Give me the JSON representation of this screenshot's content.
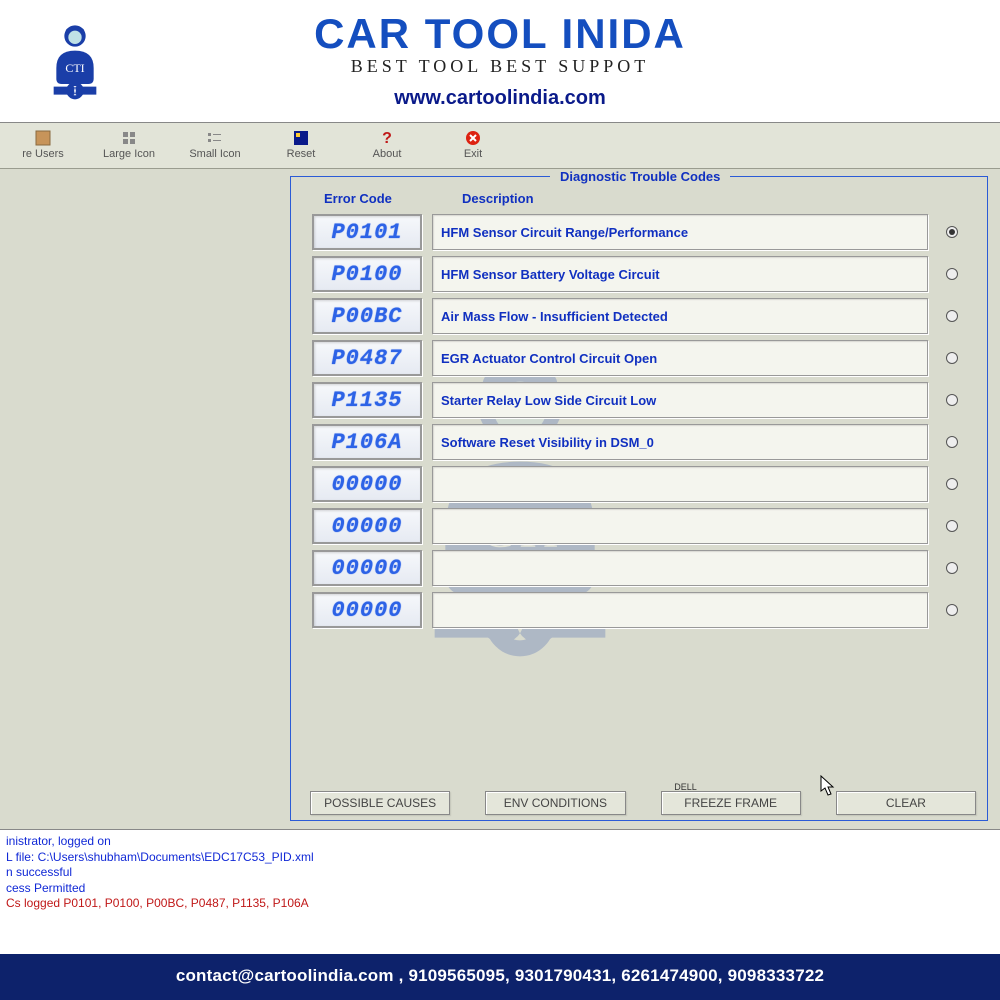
{
  "brand": {
    "title": "CAR TOOL INIDA",
    "tagline": "BEST TOOL BEST SUPPOT",
    "url": "www.cartoolindia.com",
    "logo_text": "CTI"
  },
  "toolbar": [
    {
      "name": "re-users",
      "label": "re Users"
    },
    {
      "name": "large-icon",
      "label": "Large Icon"
    },
    {
      "name": "small-icon",
      "label": "Small Icon"
    },
    {
      "name": "reset",
      "label": "Reset"
    },
    {
      "name": "about",
      "label": "About"
    },
    {
      "name": "exit",
      "label": "Exit"
    }
  ],
  "panel": {
    "title": "Diagnostic Trouble Codes",
    "header_code": "Error Code",
    "header_desc": "Description",
    "rows": [
      {
        "code": "P0101",
        "desc": "HFM Sensor Circuit Range/Performance",
        "selected": true
      },
      {
        "code": "P0100",
        "desc": "HFM Sensor Battery Voltage Circuit",
        "selected": false
      },
      {
        "code": "P00BC",
        "desc": "Air Mass Flow - Insufficient Detected",
        "selected": false
      },
      {
        "code": "P0487",
        "desc": "EGR Actuator Control Circuit Open",
        "selected": false
      },
      {
        "code": "P1135",
        "desc": "Starter Relay Low Side Circuit Low",
        "selected": false
      },
      {
        "code": "P106A",
        "desc": "Software Reset Visibility in DSM_0",
        "selected": false
      },
      {
        "code": "00000",
        "desc": "",
        "selected": false
      },
      {
        "code": "00000",
        "desc": "",
        "selected": false
      },
      {
        "code": "00000",
        "desc": "",
        "selected": false
      },
      {
        "code": "00000",
        "desc": "",
        "selected": false
      }
    ],
    "tabs": {
      "possible_causes": "POSSIBLE CAUSES",
      "env_conditions": "ENV CONDITIONS",
      "freeze_frame": "FREEZE FRAME",
      "freeze_frame_hint": "DELL",
      "clear": "CLEAR"
    }
  },
  "log": {
    "l1": "inistrator, logged on",
    "l2": "L file: C:\\Users\\shubham\\Documents\\EDC17C53_PID.xml",
    "l3": "n successful",
    "l4": "cess Permitted",
    "l5": "Cs logged P0101, P0100, P00BC, P0487, P1135, P106A"
  },
  "footer": {
    "contact": "contact@cartoolindia.com , 9109565095, 9301790431, 6261474900, 9098333722"
  }
}
